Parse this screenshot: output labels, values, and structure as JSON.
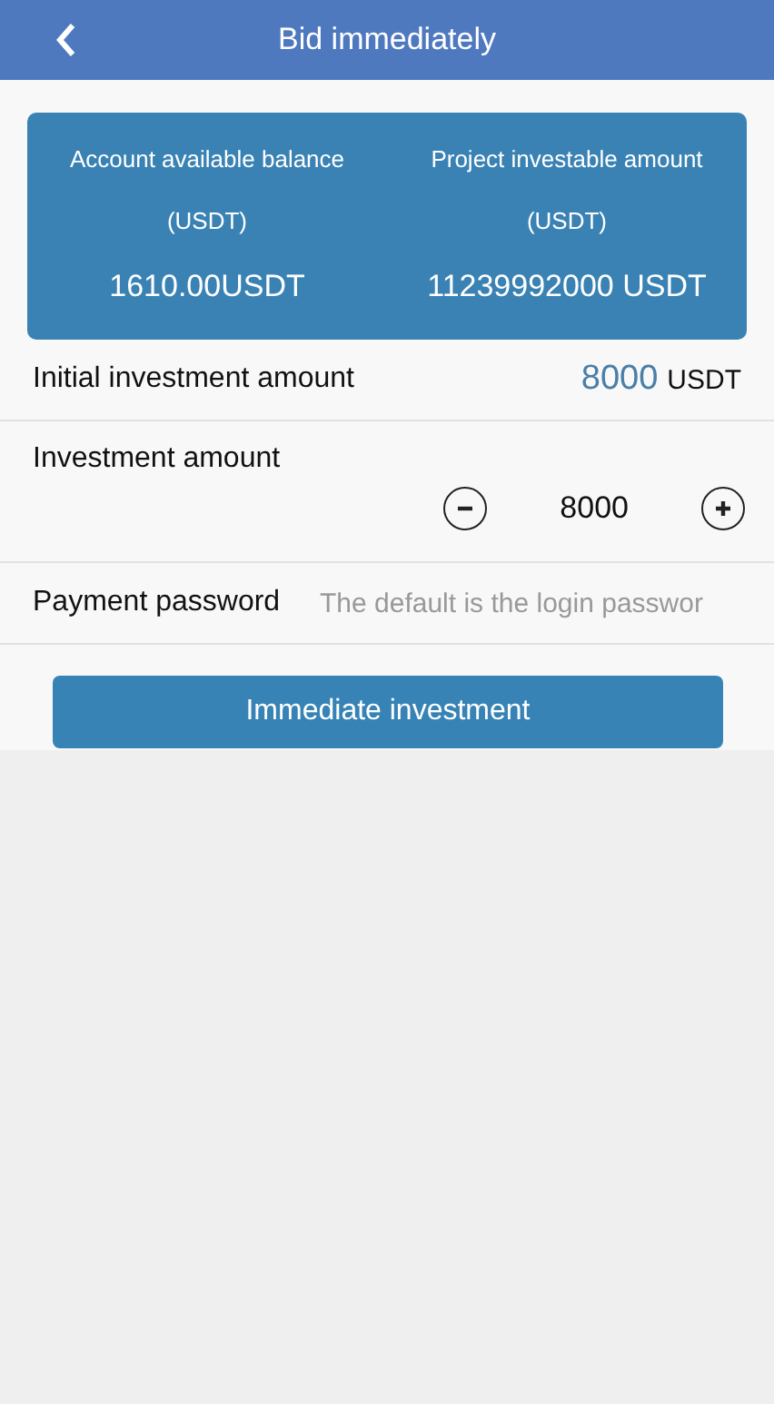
{
  "header": {
    "title": "Bid immediately"
  },
  "summary": [
    {
      "label": "Account available balance",
      "unit": "(USDT)",
      "value": "1610.00USDT"
    },
    {
      "label": "Project investable amount",
      "unit": "(USDT)",
      "value": "11239992000 USDT"
    }
  ],
  "initial": {
    "label": "Initial investment amount",
    "value": "8000",
    "unit": "USDT"
  },
  "investment": {
    "label": "Investment amount",
    "value": "8000"
  },
  "password": {
    "label": "Payment password",
    "placeholder": "The default is the login passwor"
  },
  "submit": "Immediate investment"
}
